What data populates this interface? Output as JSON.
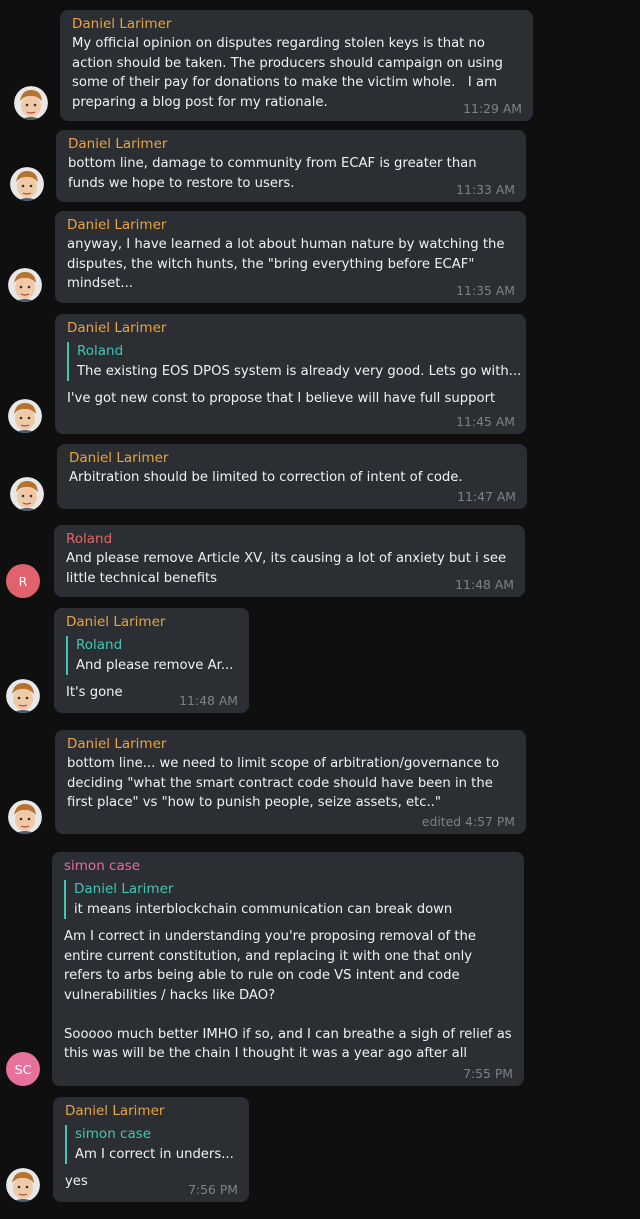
{
  "messages": [
    {
      "sender": "Daniel Larimer",
      "text": "My official opinion on disputes regarding stolen keys is that no action should be taken. The producers should campaign on using some of their pay for donations to make the victim whole.   I am preparing a blog post for my rationale.",
      "time": "11:29 AM"
    },
    {
      "sender": "Daniel Larimer",
      "text": "bottom line, damage to community from ECAF is greater than funds we hope to restore to users.",
      "time": "11:33 AM"
    },
    {
      "sender": "Daniel Larimer",
      "text": "anyway, I have learned a lot about human nature by watching the disputes, the witch hunts, the \"bring everything before ECAF\" mindset...",
      "time": "11:35 AM"
    },
    {
      "sender": "Daniel Larimer",
      "quote": {
        "name": "Roland",
        "text": "The existing EOS DPOS system is already very good. Lets go with..."
      },
      "text": "I've got new const to propose that I believe will have full support",
      "time": "11:45 AM"
    },
    {
      "sender": "Daniel Larimer",
      "text": "Arbitration should be limited to correction of intent of code.",
      "time": "11:47 AM"
    },
    {
      "sender": "Roland",
      "avatar": "R",
      "text": "And please remove Article XV, its causing a lot of anxiety but i see little technical benefits",
      "time": "11:48 AM"
    },
    {
      "sender": "Daniel Larimer",
      "quote": {
        "name": "Roland",
        "text": "And please remove Ar..."
      },
      "text": "It's gone",
      "time": "11:48 AM"
    },
    {
      "sender": "Daniel Larimer",
      "text": "bottom line... we need to limit scope of arbitration/governance to deciding \"what the smart contract code should have been in the first place\" vs \"how to punish people, seize assets, etc..\"",
      "time": "edited 4:57 PM"
    },
    {
      "sender": "simon case",
      "avatar": "SC",
      "quote": {
        "name": "Daniel Larimer",
        "text": "it means interblockchain communication can break down"
      },
      "text": "Am I correct in understanding you're proposing removal of the entire current constitution, and replacing it with one that only refers to arbs being able to rule on code VS intent and code vulnerabilities / hacks like DAO?\n\nSooooo much better IMHO if so, and I can breathe a sigh of relief as this was will be the chain I thought it was a year ago after all",
      "time": "7:55 PM"
    },
    {
      "sender": "Daniel Larimer",
      "quote": {
        "name": "simon case",
        "text": "Am I correct in unders..."
      },
      "text": "yes",
      "time": "7:56 PM"
    }
  ]
}
